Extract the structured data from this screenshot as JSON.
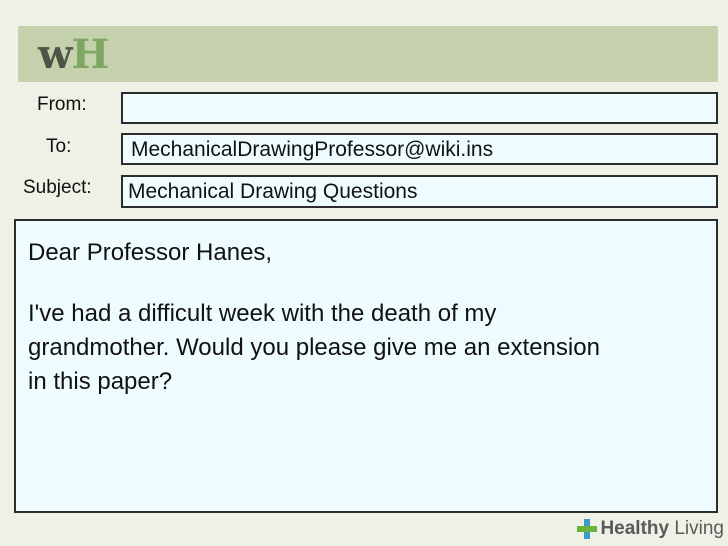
{
  "header": {
    "logo_w": "w",
    "logo_h": "H"
  },
  "email": {
    "from_label": "From:",
    "from_value": "",
    "to_label": "To:",
    "to_value": "MechanicalDrawingProfessor@wiki.ins",
    "subject_label": "Subject:",
    "subject_value": "Mechanical Drawing Questions",
    "greeting": "Dear Professor Hanes,",
    "message": "I've had a difficult week with the death of my grandmother. Would you please give me an extension in this paper?"
  },
  "footer": {
    "brand_part1": "Healthy",
    "brand_part2": " Living"
  },
  "colors": {
    "header_bar": "#c5d1ad",
    "field_background": "#eefcff",
    "logo_green": "#7fa763",
    "cross_blue": "#3f9ac6",
    "cross_green": "#6cb33e"
  }
}
